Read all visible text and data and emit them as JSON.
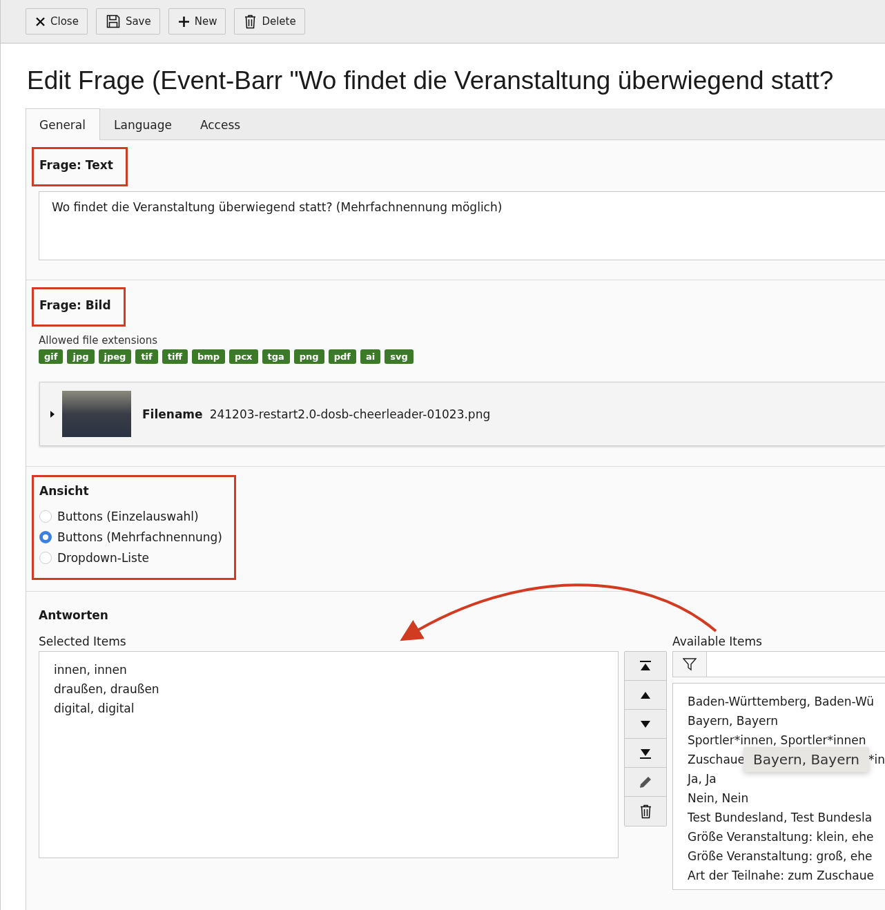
{
  "toolbar": {
    "buttons": [
      {
        "kind": "close",
        "label": "Close"
      },
      {
        "kind": "save",
        "label": "Save"
      },
      {
        "kind": "new",
        "label": "New"
      },
      {
        "kind": "delete",
        "label": "Delete"
      }
    ]
  },
  "title": "Edit Frage (Event-Barr \"Wo findet die Veranstaltung überwiegend statt?",
  "tabs": [
    {
      "label": "General",
      "selected": true
    },
    {
      "label": "Language",
      "selected": false
    },
    {
      "label": "Access",
      "selected": false
    }
  ],
  "text_field": {
    "label": "Frage: Text",
    "value": "Wo findet die Veranstaltung überwiegend statt? (Mehrfachnennung möglich)"
  },
  "image_field": {
    "label": "Frage: Bild",
    "allowed_label": "Allowed file extensions",
    "extensions": [
      "gif",
      "jpg",
      "jpeg",
      "tif",
      "tiff",
      "bmp",
      "pcx",
      "tga",
      "png",
      "pdf",
      "ai",
      "svg"
    ],
    "file": {
      "expanded": false,
      "label": "Filename",
      "value": "241203-restart2.0-dosb-cheerleader-01023.png"
    }
  },
  "view_field": {
    "label": "Ansicht",
    "options": [
      {
        "label": "Buttons (Einzelauswahl)",
        "selected": false
      },
      {
        "label": "Buttons (Mehrfachnennung)",
        "selected": true
      },
      {
        "label": "Dropdown-Liste",
        "selected": false
      }
    ]
  },
  "answers": {
    "label": "Antworten",
    "selected_label": "Selected Items",
    "selected_items": [
      "innen, innen",
      "draußen, draußen",
      "digital, digital"
    ],
    "available_label": "Available Items",
    "available_items": [
      "Baden-Württemberg, Baden-Wü",
      "Bayern, Bayern",
      "Sportler*innen, Sportler*innen",
      {
        "text": "Zuschaue",
        "tail": "*in"
      },
      "Ja, Ja",
      "Nein, Nein",
      "Test Bundesland, Test Bundesla",
      "Größe Veranstaltung: klein, ehe",
      "Größe Veranstaltung: groß, ehe",
      "Art der Teilnahe: zum Zuschaue"
    ],
    "tooltip": "Bayern, Bayern"
  }
}
